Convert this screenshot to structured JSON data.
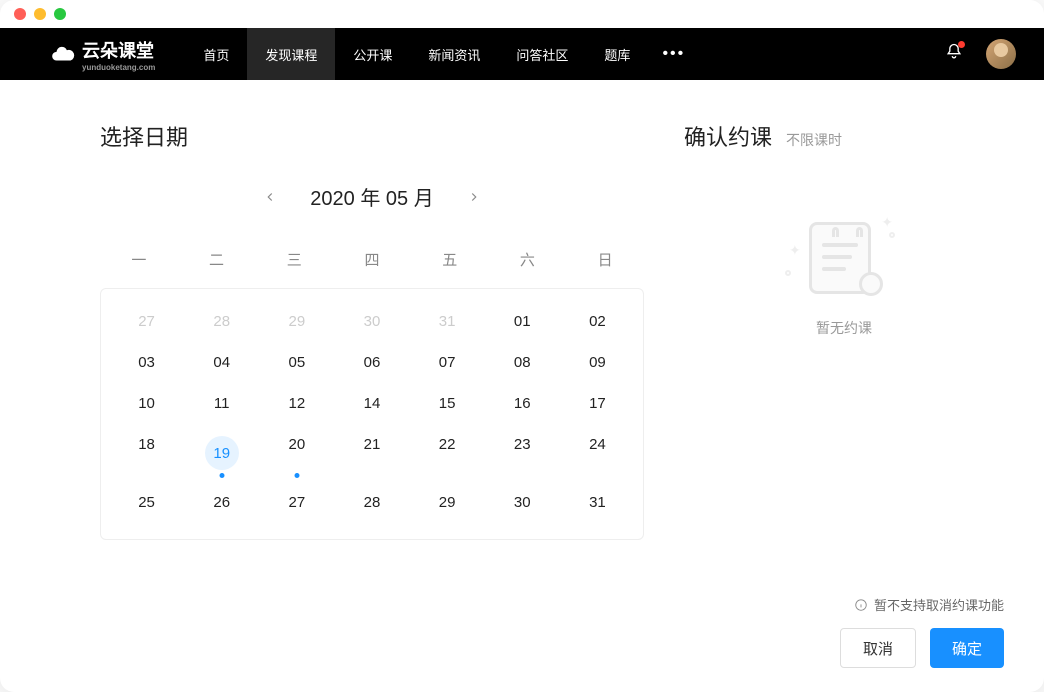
{
  "logo": {
    "text": "云朵课堂",
    "sub": "yunduoketang.com"
  },
  "nav": {
    "items": [
      "首页",
      "发现课程",
      "公开课",
      "新闻资讯",
      "问答社区",
      "题库"
    ],
    "active_index": 1
  },
  "left": {
    "title": "选择日期",
    "month_label": "2020 年 05 月",
    "weekdays": [
      "一",
      "二",
      "三",
      "四",
      "五",
      "六",
      "日"
    ],
    "days": [
      {
        "n": "27",
        "other": true
      },
      {
        "n": "28",
        "other": true
      },
      {
        "n": "29",
        "other": true
      },
      {
        "n": "30",
        "other": true
      },
      {
        "n": "31",
        "other": true
      },
      {
        "n": "01"
      },
      {
        "n": "02"
      },
      {
        "n": "03"
      },
      {
        "n": "04"
      },
      {
        "n": "05"
      },
      {
        "n": "06"
      },
      {
        "n": "07"
      },
      {
        "n": "08"
      },
      {
        "n": "09"
      },
      {
        "n": "10"
      },
      {
        "n": "11"
      },
      {
        "n": "12"
      },
      {
        "n": "14"
      },
      {
        "n": "15"
      },
      {
        "n": "16"
      },
      {
        "n": "17"
      },
      {
        "n": "18"
      },
      {
        "n": "19",
        "today": true,
        "dot": true
      },
      {
        "n": "20",
        "dot": true
      },
      {
        "n": "21"
      },
      {
        "n": "22"
      },
      {
        "n": "23"
      },
      {
        "n": "24"
      },
      {
        "n": "25"
      },
      {
        "n": "26"
      },
      {
        "n": "27"
      },
      {
        "n": "28"
      },
      {
        "n": "29"
      },
      {
        "n": "30"
      },
      {
        "n": "31"
      }
    ]
  },
  "right": {
    "title": "确认约课",
    "sub": "不限课时",
    "empty_text": "暂无约课",
    "footer_note": "暂不支持取消约课功能",
    "cancel_label": "取消",
    "confirm_label": "确定"
  }
}
